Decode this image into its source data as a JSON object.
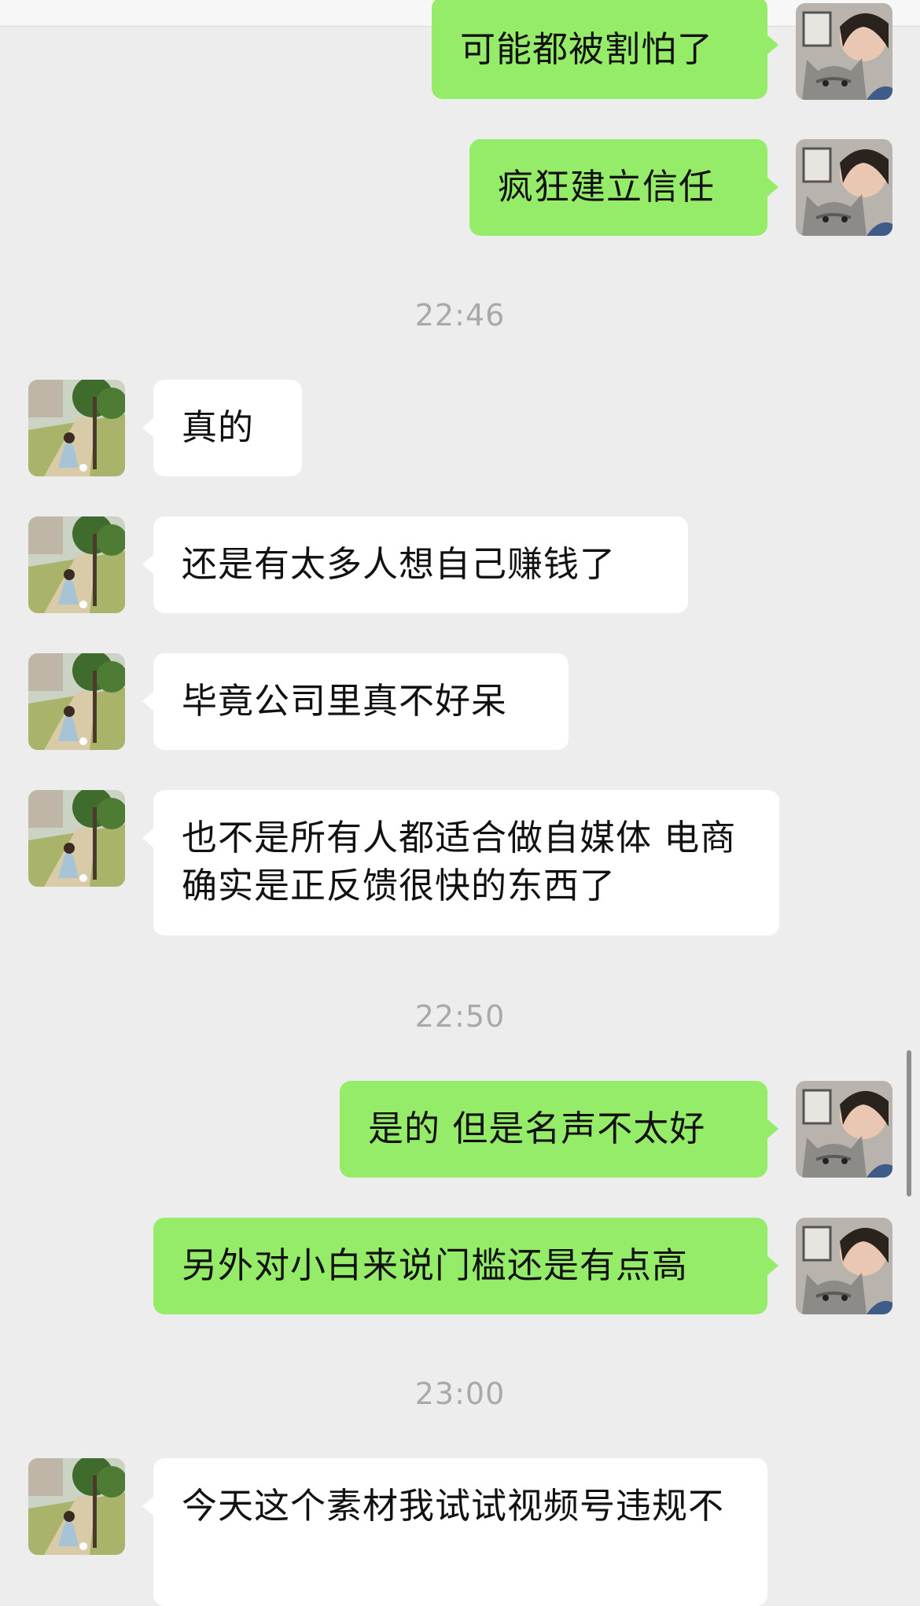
{
  "messages": [
    {
      "side": "right",
      "text": "可能都被割怕了"
    },
    {
      "side": "right",
      "text": "疯狂建立信任"
    },
    {
      "time": "22:46"
    },
    {
      "side": "left",
      "text": "真的"
    },
    {
      "side": "left",
      "text": "还是有太多人想自己赚钱了"
    },
    {
      "side": "left",
      "text": "毕竟公司里真不好呆"
    },
    {
      "side": "left",
      "text": "也不是所有人都适合做自媒体 电商确实是正反馈很快的东西了"
    },
    {
      "time": "22:50"
    },
    {
      "side": "right",
      "text": "是的 但是名声不太好"
    },
    {
      "side": "right",
      "text": "另外对小白来说门槛还是有点高"
    },
    {
      "time": "23:00"
    },
    {
      "side": "left",
      "text": "今天这个素材我试试视频号违规不"
    }
  ],
  "colors": {
    "background": "#ededed",
    "bubble_self": "#95ec69",
    "bubble_other": "#ffffff",
    "timestamp": "#a9a9a9"
  }
}
